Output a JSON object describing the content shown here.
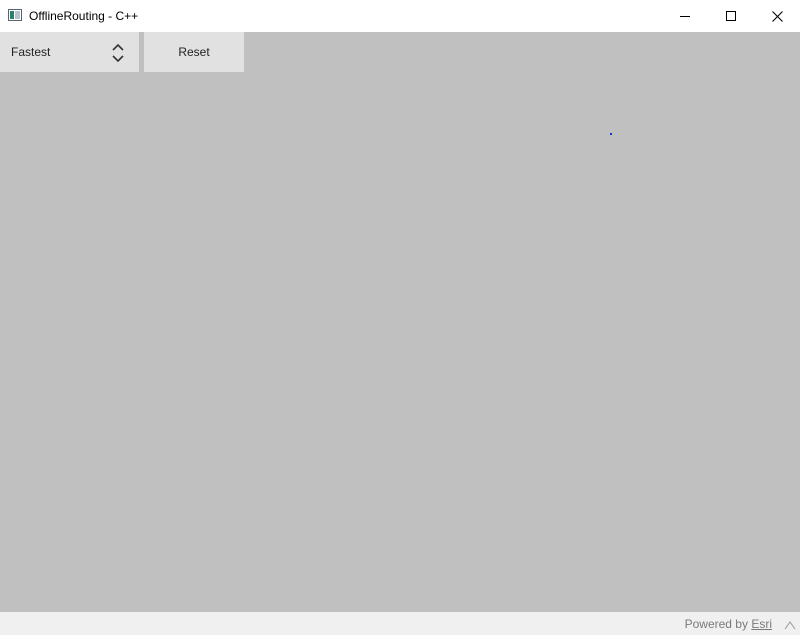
{
  "window": {
    "title": "OfflineRouting - C++"
  },
  "toolbar": {
    "travel_mode": {
      "selected": "Fastest"
    },
    "reset_label": "Reset"
  },
  "attribution": {
    "prefix": "Powered by",
    "link": "Esri"
  },
  "icons": {
    "app": "app-window-icon",
    "minimize": "minimize-icon",
    "maximize": "maximize-icon",
    "close": "close-icon",
    "select_arrows": "chevron-up-down-icon",
    "expand": "chevron-up-icon"
  },
  "colors": {
    "map_background": "#c0c0c0",
    "stop_point": "#1f2bd0",
    "control_background": "#e1e1e1"
  }
}
